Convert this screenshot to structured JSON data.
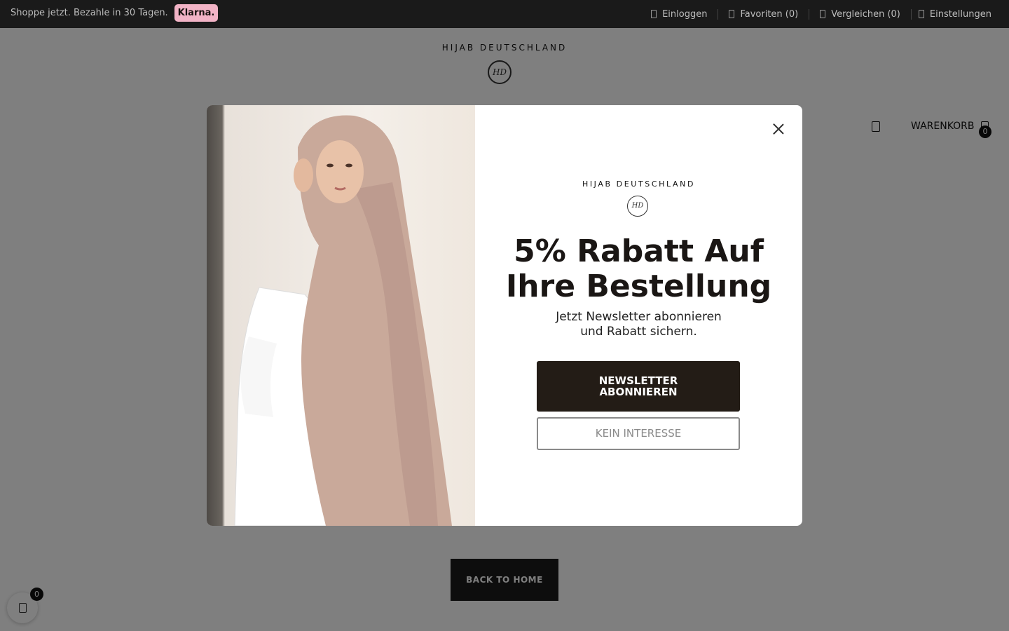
{
  "topbar": {
    "promo": "Shoppe jetzt. Bezahle in 30 Tagen.",
    "klarna": "Klarna.",
    "links": [
      {
        "label": "Einloggen",
        "icon": "user-icon"
      },
      {
        "label": "Favoriten (0)",
        "icon": "heart-icon"
      },
      {
        "label": "Vergleichen (0)",
        "icon": "compare-icon"
      },
      {
        "label": "Einstellungen",
        "icon": "settings-icon"
      }
    ]
  },
  "header": {
    "brand": "HIJAB DEUTSCHLAND",
    "monogram": "HD",
    "cart_label": "WARENKORB",
    "cart_count": "0"
  },
  "page": {
    "back_button": "BACK TO HOME",
    "wishlist_count": "0"
  },
  "modal": {
    "brand": "HIJAB DEUTSCHLAND",
    "monogram": "HD",
    "headline_line1": "5% Rabatt Auf",
    "headline_line2": "Ihre Bestellung",
    "sub_line1": "Jetzt Newsletter abonnieren",
    "sub_line2": "und Rabatt sichern.",
    "primary_line1": "NEWSLETTER",
    "primary_line2": "ABONNIEREN",
    "secondary": "KEIN INTERESSE"
  },
  "colors": {
    "topbar_bg": "#1a1a1a",
    "klarna_pink": "#f2b3c6",
    "primary_button": "#231c16",
    "overlay": "rgba(0,0,0,0.5)"
  }
}
